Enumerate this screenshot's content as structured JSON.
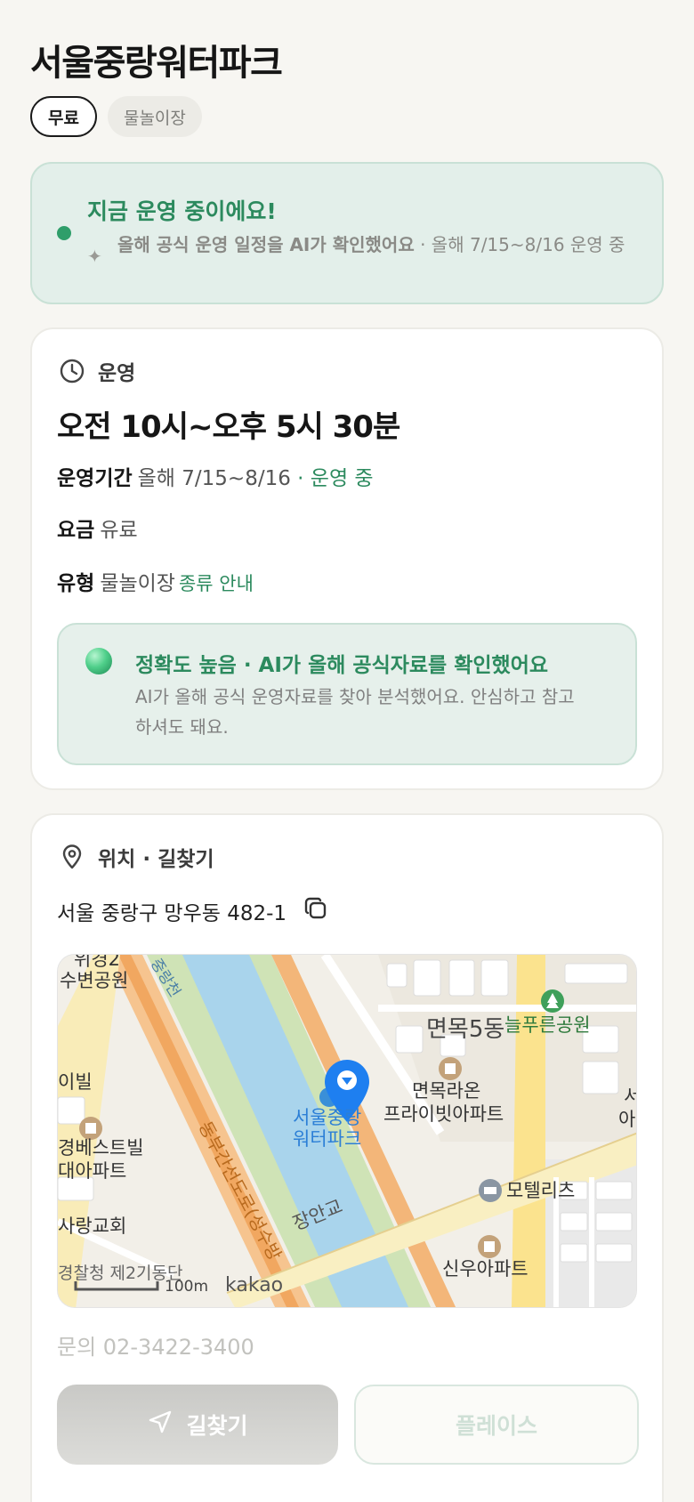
{
  "title": "서울중랑워터파크",
  "chips": [
    {
      "label": "무료",
      "active": true
    },
    {
      "label": "물놀이장",
      "active": false
    }
  ],
  "status": {
    "title": "지금 운영 중이에요!",
    "desc_bold": "올해 공식 운영 일정을 AI가 확인했어요",
    "desc_rest": " · 올해 7/15~8/16 운영 중",
    "dot_color": "#2f9e6a"
  },
  "hours": {
    "section_label": "운영",
    "time": "오전 10시~오후 5시 30분",
    "period_label": "운영기간",
    "period_value": "올해 7/15~8/16",
    "period_status": "· 운영 중",
    "fee_label": "요금",
    "fee_value": "유료",
    "type_label": "유형",
    "type_value": "물놀이장",
    "type_link": "종류 안내"
  },
  "accuracy": {
    "title": "정확도 높음 · AI가 올해 공식자료를 확인했어요",
    "desc": "AI가 올해 공식 운영자료를 찾아 분석했어요. 안심하고 참고하셔도 돼요."
  },
  "location": {
    "section_label": "위치 · 길찾기",
    "address": "서울 중랑구 망우동 482-1",
    "phone": "문의 02-3422-3400"
  },
  "map": {
    "labels": {
      "park_top_left": "위경2",
      "park_top_left2": "수변공원",
      "stream": "중랑천",
      "area": "면목5동",
      "park_right": "늘푸른공원",
      "apt1_a": "면목라온",
      "apt1_b": "프라이빗아파트",
      "pin_a": "서울중랑",
      "pin_b": "워터파크",
      "left1": "이빌",
      "left2": "경베스트빌",
      "left3": "대아파트",
      "left4": "사랑교회",
      "left5": "경찰청 제2기동단",
      "road1": "동부간선도로(성수방",
      "bridge": "장안교",
      "motel": "모텔리츠",
      "apt2": "신우아파트",
      "edge_a": "서",
      "edge_b": "아",
      "scale": "100m",
      "brand": "kakao"
    }
  },
  "buttons": {
    "navigate": "길찾기",
    "place": "플레이스"
  }
}
